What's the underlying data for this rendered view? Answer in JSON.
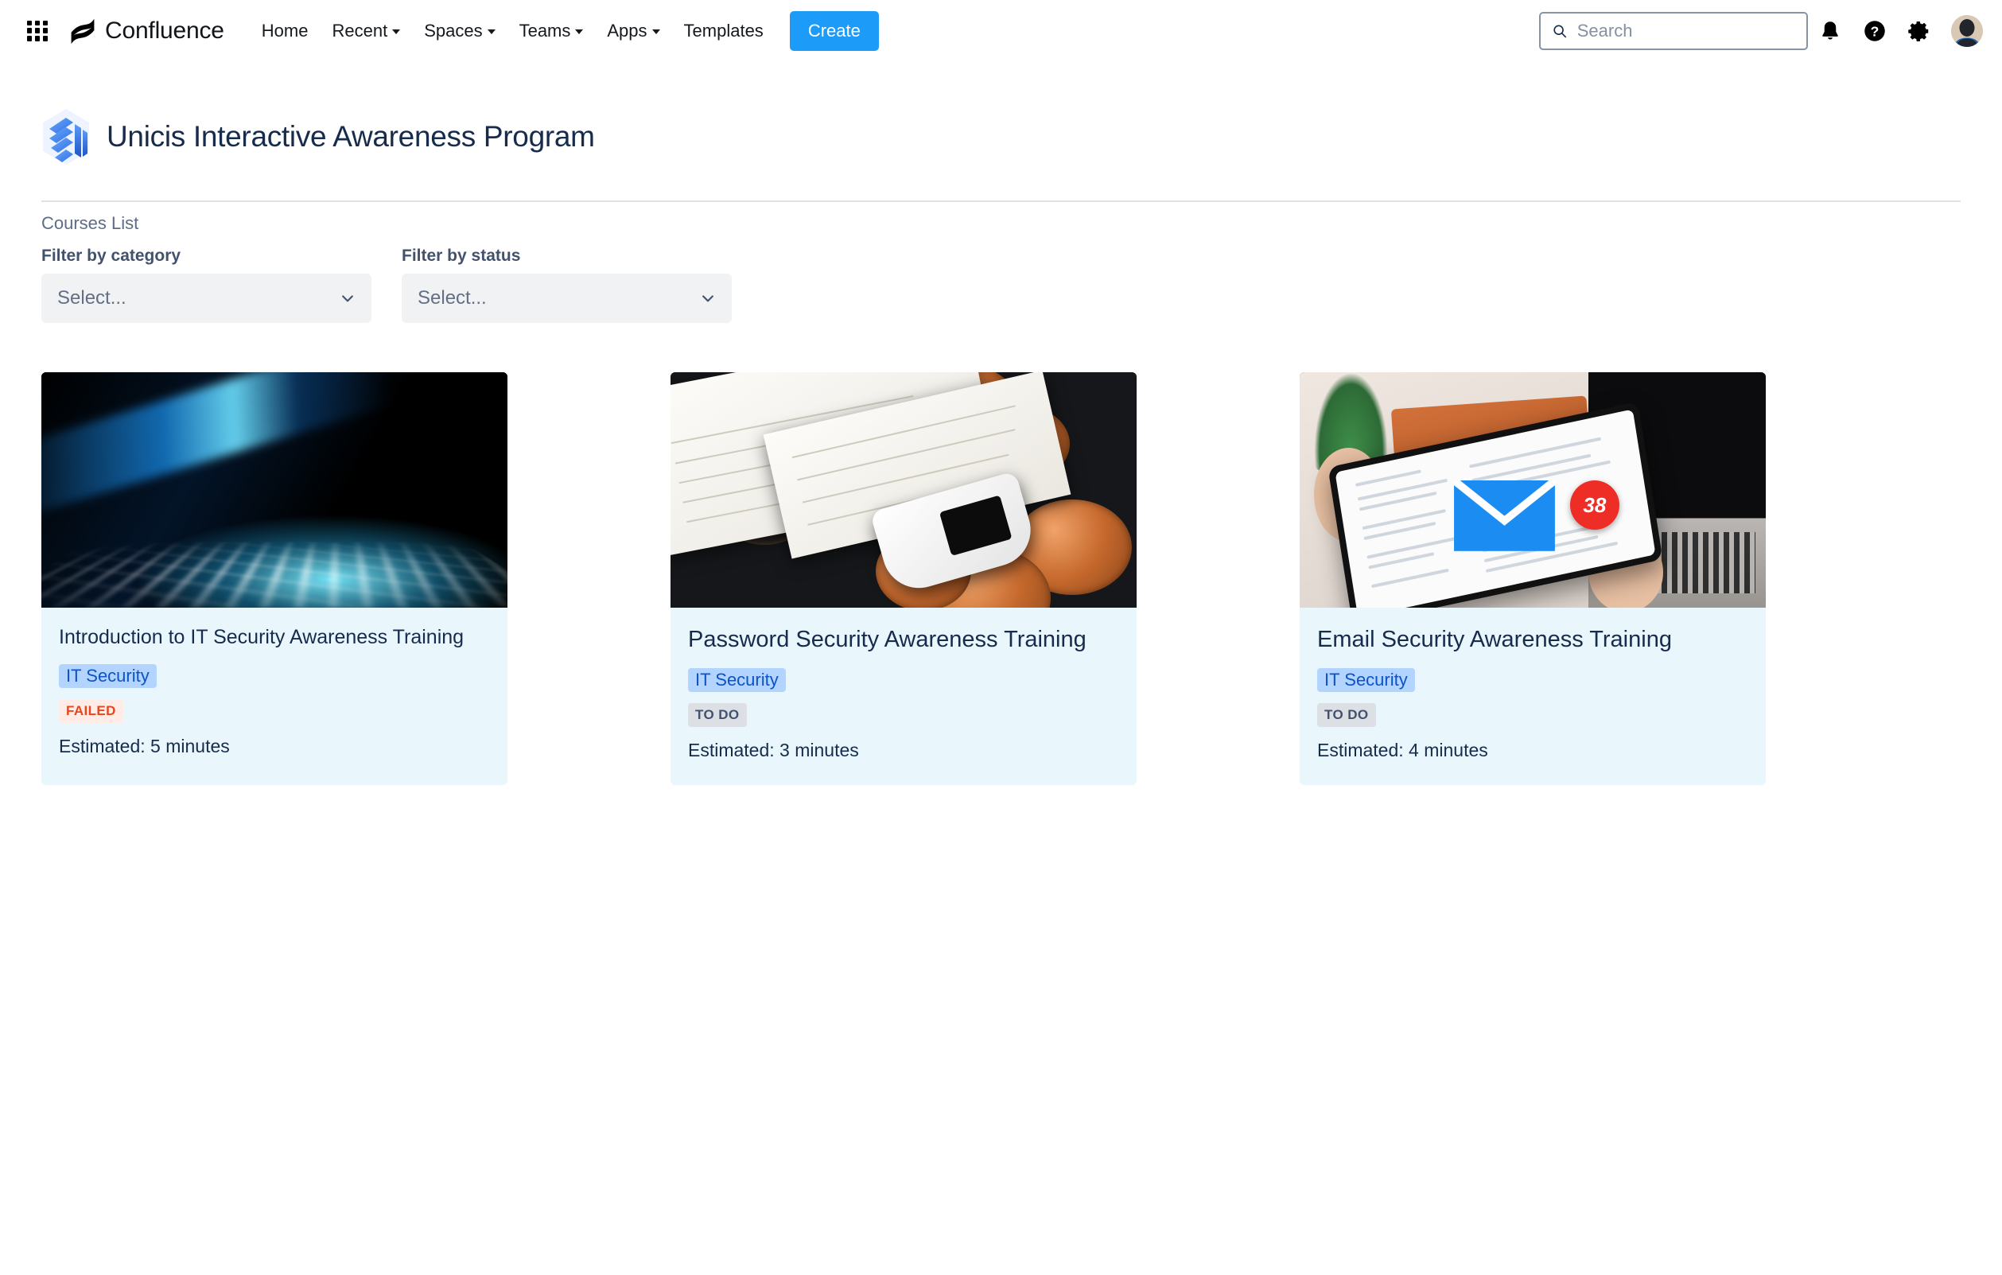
{
  "topnav": {
    "brand_name": "Confluence",
    "links": [
      {
        "label": "Home",
        "has_caret": false
      },
      {
        "label": "Recent",
        "has_caret": true
      },
      {
        "label": "Spaces",
        "has_caret": true
      },
      {
        "label": "Teams",
        "has_caret": true
      },
      {
        "label": "Apps",
        "has_caret": true
      },
      {
        "label": "Templates",
        "has_caret": false
      }
    ],
    "create_label": "Create",
    "search_placeholder": "Search",
    "search_value": "",
    "icons": [
      "app-switcher-icon",
      "notifications-icon",
      "help-icon",
      "settings-icon",
      "avatar"
    ]
  },
  "page": {
    "title": "Unicis Interactive Awareness Program",
    "section_label": "Courses List"
  },
  "filters": [
    {
      "label": "Filter by category",
      "value": "Select...",
      "name": "category"
    },
    {
      "label": "Filter by status",
      "value": "Select...",
      "name": "status"
    }
  ],
  "cards": [
    {
      "title": "Introduction to IT Security Awareness Training",
      "tag": "IT Security",
      "status": "FAILED",
      "status_kind": "failed",
      "estimate": "Estimated: 5 minutes",
      "title_size": "small",
      "image": "backlit-laptop-keyboard-photo"
    },
    {
      "title": "Password Security Awareness Training",
      "tag": "IT Security",
      "status": "TO DO",
      "status_kind": "todo",
      "estimate": "Estimated: 3 minutes",
      "title_size": "large",
      "image": "crypto-coins-recovery-seed-card-photo"
    },
    {
      "title": "Email Security Awareness Training",
      "tag": "IT Security",
      "status": "TO DO",
      "status_kind": "todo",
      "estimate": "Estimated: 4 minutes",
      "title_size": "large",
      "image": "tablet-email-inbox-badge-photo",
      "image_badge": "38"
    }
  ],
  "colors": {
    "accent_blue": "#1d9bf8",
    "card_bg": "#e9f7fd",
    "tag_bg": "#b3d4ff",
    "tag_text": "#0c53c4",
    "failed_bg": "#ffece6",
    "failed_text": "#e5471f",
    "todo_bg": "#dcdfe4",
    "todo_text": "#42526e",
    "title_text": "#172b4d",
    "logo_blue": "#3b82f6"
  }
}
